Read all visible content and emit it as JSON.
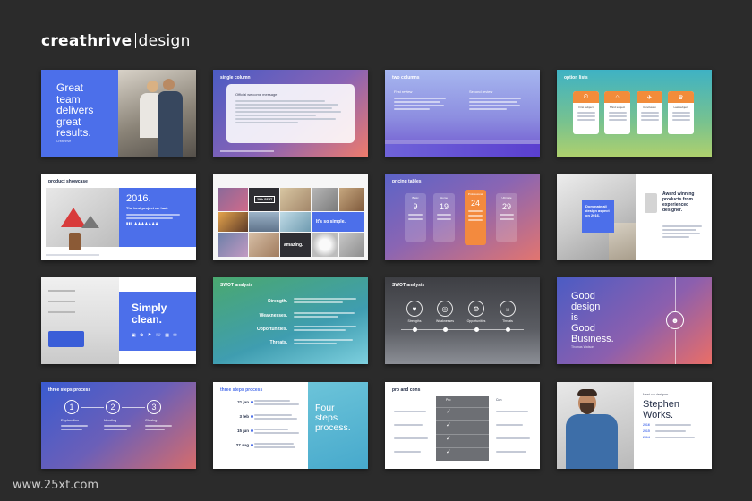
{
  "brand": {
    "name_bold": "creathrive",
    "name_light": "design"
  },
  "watermark": "www.25xt.com",
  "slides": {
    "s1": {
      "headline_lines": [
        "Great",
        "team",
        "delivers",
        "great",
        "results."
      ],
      "caption": "Creathrive"
    },
    "s2": {
      "title": "single column",
      "card_title": "Official welcome message"
    },
    "s3": {
      "title": "two columns",
      "col1": "First review",
      "col2": "Second review"
    },
    "s4": {
      "title": "option lists",
      "options": [
        "First subject",
        "Third subject",
        "Conclusion",
        "Last subject"
      ],
      "icons": [
        "⏲",
        "⌂",
        "✈",
        "♛"
      ]
    },
    "s5": {
      "title": "product showcase",
      "year": "2016.",
      "subtitle": "The best project we had.",
      "icons": "▮▮▮ ♟♟♟♟♟♟♟"
    },
    "s6": {
      "tile_date": "29th SEPT",
      "tile_simple": "It's so simple.",
      "tile_amazing": "amazing."
    },
    "s7": {
      "title": "pricing tables",
      "tiers": [
        {
          "label": "Basic",
          "price": "9"
        },
        {
          "label": "Home",
          "price": "19"
        },
        {
          "label": "Professional",
          "price": "24"
        },
        {
          "label": "Ultimate",
          "price": "29"
        }
      ]
    },
    "s8": {
      "square_text": "Dominate all design aspect on 2016.",
      "award_text": "Award winning products from experienced designer."
    },
    "s9": {
      "headline": "Simply clean.",
      "icons": "▣ ✿ ⚑ ☏ ▦ ✉"
    },
    "s10": {
      "title": "SWOT analysis",
      "words": [
        "Strength.",
        "Weaknesses.",
        "Opportunities.",
        "Threats."
      ]
    },
    "s11": {
      "title": "SWOT analysis",
      "items": [
        {
          "label": "Strengths",
          "icon": "♥"
        },
        {
          "label": "Weaknesses",
          "icon": "◎"
        },
        {
          "label": "Opportunities",
          "icon": "⚙"
        },
        {
          "label": "Threats",
          "icon": "☼"
        }
      ]
    },
    "s12": {
      "headline_lines": [
        "Good",
        "design",
        "is",
        "Good",
        "Business."
      ],
      "caption": "Thomas Watson",
      "icon": "☻"
    },
    "s13": {
      "title": "three steps process",
      "steps": [
        {
          "num": "1",
          "label": "Exploration"
        },
        {
          "num": "2",
          "label": "Ideating"
        },
        {
          "num": "3",
          "label": "Closing"
        }
      ]
    },
    "s14": {
      "title": "three steps process",
      "headline_lines": [
        "Four",
        "steps",
        "process."
      ],
      "dates": [
        "21 jan",
        "3 feb",
        "15 jun",
        "27 aug"
      ]
    },
    "s15": {
      "title": "pro and cons",
      "label_pro": "Pro",
      "label_con": "Con",
      "check": "✓"
    },
    "s16": {
      "meet": "Meet our designer.",
      "name_lines": [
        "Stephen",
        "Works."
      ],
      "years": [
        "2016",
        "2015",
        "2014"
      ]
    }
  }
}
